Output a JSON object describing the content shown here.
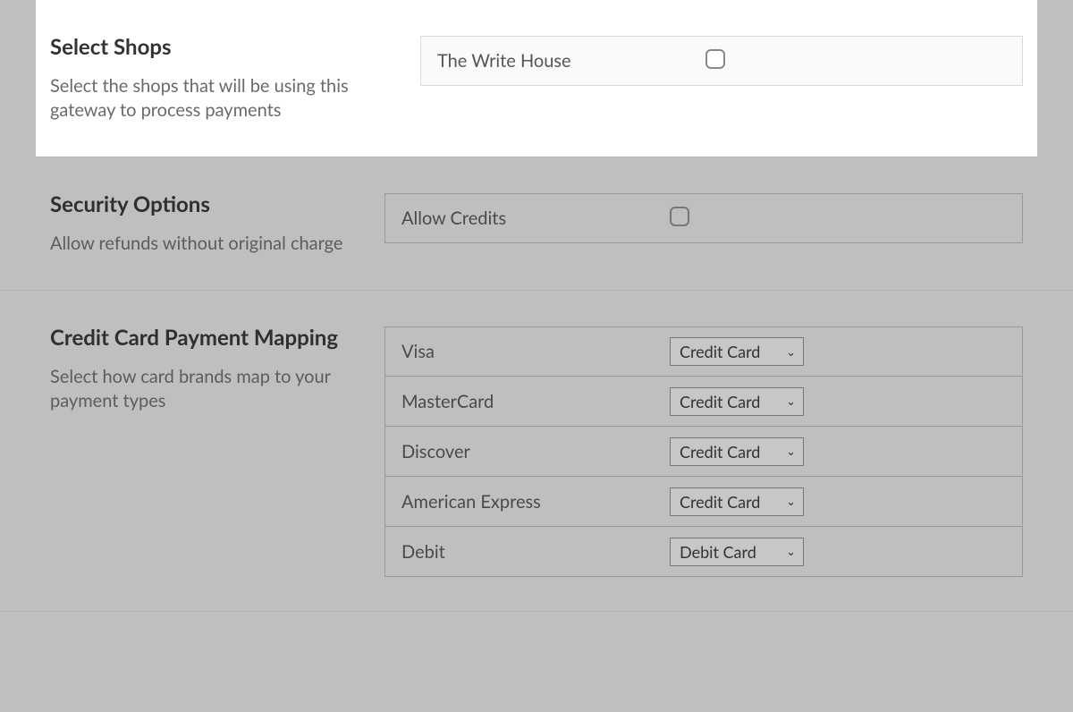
{
  "shops": {
    "title": "Select Shops",
    "desc": "Select the shops that will be using this gateway to process payments",
    "row_label": "The Write House"
  },
  "security": {
    "title": "Security Options",
    "desc": "Allow refunds without original charge",
    "row_label": "Allow Credits"
  },
  "mapping": {
    "title": "Credit Card Payment Mapping",
    "desc": "Select how card brands map to your payment types",
    "rows": {
      "visa": {
        "label": "Visa",
        "value": "Credit Card"
      },
      "mc": {
        "label": "MasterCard",
        "value": "Credit Card"
      },
      "discover": {
        "label": "Discover",
        "value": "Credit Card"
      },
      "amex": {
        "label": "American Express",
        "value": "Credit Card"
      },
      "debit": {
        "label": "Debit",
        "value": "Debit Card"
      }
    }
  }
}
